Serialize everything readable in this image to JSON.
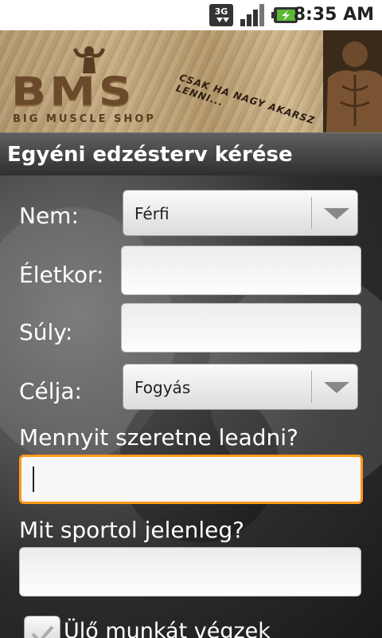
{
  "status_bar": {
    "time": "8:35 AM",
    "network_label": "3G",
    "icons": [
      "3g-data-icon",
      "signal-icon",
      "battery-charging-icon"
    ]
  },
  "banner": {
    "logo_text": "BMS",
    "logo_subtitle": "BIG MUSCLE SHOP",
    "slogan": "CSAK HA NAGY AKARSZ LENNI..."
  },
  "header": {
    "title": "Egyéni edzésterv kérése"
  },
  "form": {
    "gender": {
      "label": "Nem:",
      "value": "Férfi"
    },
    "age": {
      "label": "Életkor:",
      "value": ""
    },
    "weight": {
      "label": "Súly:",
      "value": ""
    },
    "goal": {
      "label": "Célja:",
      "value": "Fogyás"
    },
    "lose_amount": {
      "label": "Mennyit szeretne leadni?",
      "value": ""
    },
    "current_sport": {
      "label": "Mit sportol jelenleg?",
      "value": ""
    },
    "sedentary": {
      "label": "Ülő munkát végzek",
      "checked": false
    }
  },
  "colors": {
    "focus": "#ff9a1a",
    "title_bar": "#3a3a3a"
  }
}
